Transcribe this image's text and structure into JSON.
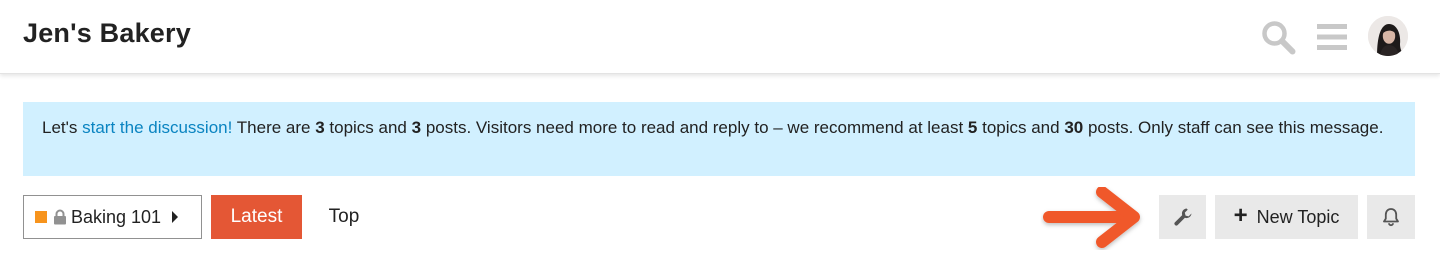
{
  "header": {
    "site_title": "Jen's Bakery",
    "icons": [
      "search-icon",
      "hamburger-menu-icon",
      "user-avatar"
    ]
  },
  "banner": {
    "text_1": "Let's ",
    "link": "start the discussion!",
    "text_2": " There are ",
    "topics_count": "3",
    "text_3": " topics and ",
    "posts_count": "3",
    "text_4": " posts. Visitors need more to read and reply to – we recommend at least ",
    "min_topics": "5",
    "text_5": " topics and ",
    "min_posts": "30",
    "text_6": " posts. Only staff can see this message."
  },
  "navigation": {
    "category_label": "Baking 101",
    "category_color": "#f7941d",
    "tabs": [
      {
        "label": "Latest",
        "active": true
      },
      {
        "label": "Top",
        "active": false
      }
    ]
  },
  "actions": {
    "new_topic_label": "New Topic",
    "icons": [
      "wrench-icon",
      "plus-icon",
      "bell-icon",
      "arrow-icon"
    ]
  },
  "colors": {
    "accent": "#e45735",
    "banner_bg": "#d1f0ff",
    "link": "#0a84c1",
    "button_bg": "#e9e9e9"
  }
}
